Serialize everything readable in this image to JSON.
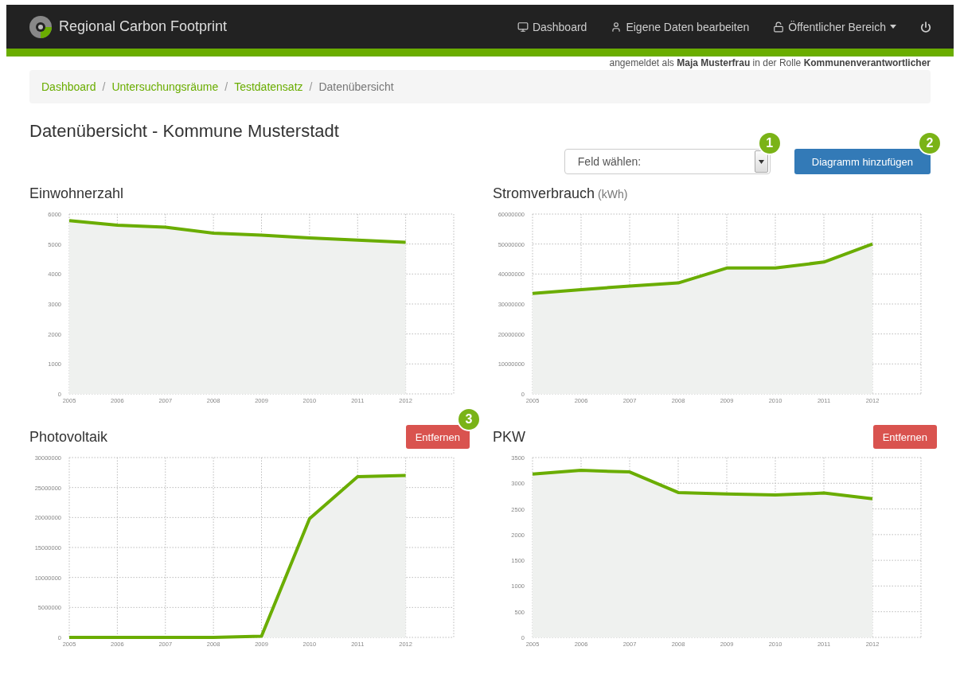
{
  "navbar": {
    "brand": "Regional Carbon Footprint",
    "items": [
      {
        "kind": "link",
        "label": "Dashboard"
      },
      {
        "kind": "link",
        "label": "Eigene Daten bearbeiten"
      },
      {
        "kind": "dropdown",
        "label": "Öffentlicher Bereich"
      },
      {
        "kind": "power"
      }
    ]
  },
  "login_info": "angemeldet als **Maja Musterfrau** in der Rolle **Kommunenverantwortlicher**",
  "breadcrumb": {
    "separator": "/",
    "items": [
      {
        "label": "Dashboard",
        "active": false
      },
      {
        "label": "Untersuchungsräume",
        "active": false
      },
      {
        "label": "Testdatensatz",
        "active": false
      },
      {
        "label": "Datenübersicht",
        "active": true
      }
    ]
  },
  "page_title": "Datenübersicht - Kommune Musterstadt",
  "field_select": {
    "placeholder": "Feld wählen:",
    "badge": "1"
  },
  "add_button": {
    "label": "Diagramm hinzufügen",
    "badge": "2"
  },
  "charts": [
    {
      "title": "Einwohnerzahl",
      "chart_data": {
        "type": "area",
        "x": [
          2005,
          2006,
          2007,
          2008,
          2009,
          2010,
          2011,
          2012
        ],
        "xlim": [
          2005,
          2013
        ],
        "xticks": [
          2005,
          2006,
          2007,
          2008,
          2009,
          2010,
          2011,
          2012
        ],
        "ylim": [
          0,
          6000
        ],
        "yticks": [
          0,
          1000,
          2000,
          3000,
          4000,
          5000,
          6000
        ],
        "grid": true,
        "series": [
          {
            "color": "#6aad00",
            "values": [
              5780,
              5630,
              5560,
              5360,
              5300,
              5200,
              5130,
              5060
            ]
          }
        ]
      }
    },
    {
      "title": "Stromverbrauch",
      "unit": "(kWh)",
      "chart_data": {
        "type": "area",
        "x": [
          2005,
          2006,
          2007,
          2008,
          2009,
          2010,
          2011,
          2012
        ],
        "xlim": [
          2005,
          2013
        ],
        "xticks": [
          2005,
          2006,
          2007,
          2008,
          2009,
          2010,
          2011,
          2012
        ],
        "ylim": [
          0,
          60000000
        ],
        "yticks": [
          0,
          10000000,
          20000000,
          30000000,
          40000000,
          50000000,
          60000000
        ],
        "grid": true,
        "series": [
          {
            "color": "#6aad00",
            "values": [
              33500000,
              34800000,
              36000000,
              37000000,
              42000000,
              42000000,
              44000000,
              50000000
            ]
          }
        ]
      }
    },
    {
      "title": "Photovoltaik",
      "remove_button": {
        "label": "Entfernen",
        "badge": "3"
      },
      "chart_data": {
        "type": "area",
        "x": [
          2005,
          2006,
          2007,
          2008,
          2009,
          2010,
          2011,
          2012
        ],
        "xlim": [
          2005,
          2013
        ],
        "xticks": [
          2005,
          2006,
          2007,
          2008,
          2009,
          2010,
          2011,
          2012
        ],
        "ylim": [
          0,
          30000000
        ],
        "yticks": [
          0,
          5000000,
          10000000,
          15000000,
          20000000,
          25000000,
          30000000
        ],
        "grid": true,
        "series": [
          {
            "color": "#6aad00",
            "values": [
              0,
              0,
              0,
              0,
              200000,
              19800000,
              26800000,
              27000000
            ]
          }
        ]
      }
    },
    {
      "title": "PKW",
      "remove_button": {
        "label": "Entfernen"
      },
      "chart_data": {
        "type": "area",
        "x": [
          2005,
          2006,
          2007,
          2008,
          2009,
          2010,
          2011,
          2012
        ],
        "xlim": [
          2005,
          2013
        ],
        "xticks": [
          2005,
          2006,
          2007,
          2008,
          2009,
          2010,
          2011,
          2012
        ],
        "ylim": [
          0,
          3500
        ],
        "yticks": [
          0,
          500,
          1000,
          1500,
          2000,
          2500,
          3000,
          3500
        ],
        "grid": true,
        "series": [
          {
            "color": "#6aad00",
            "values": [
              3180,
              3250,
              3220,
              2820,
              2790,
              2770,
              2810,
              2700
            ]
          }
        ]
      }
    }
  ]
}
